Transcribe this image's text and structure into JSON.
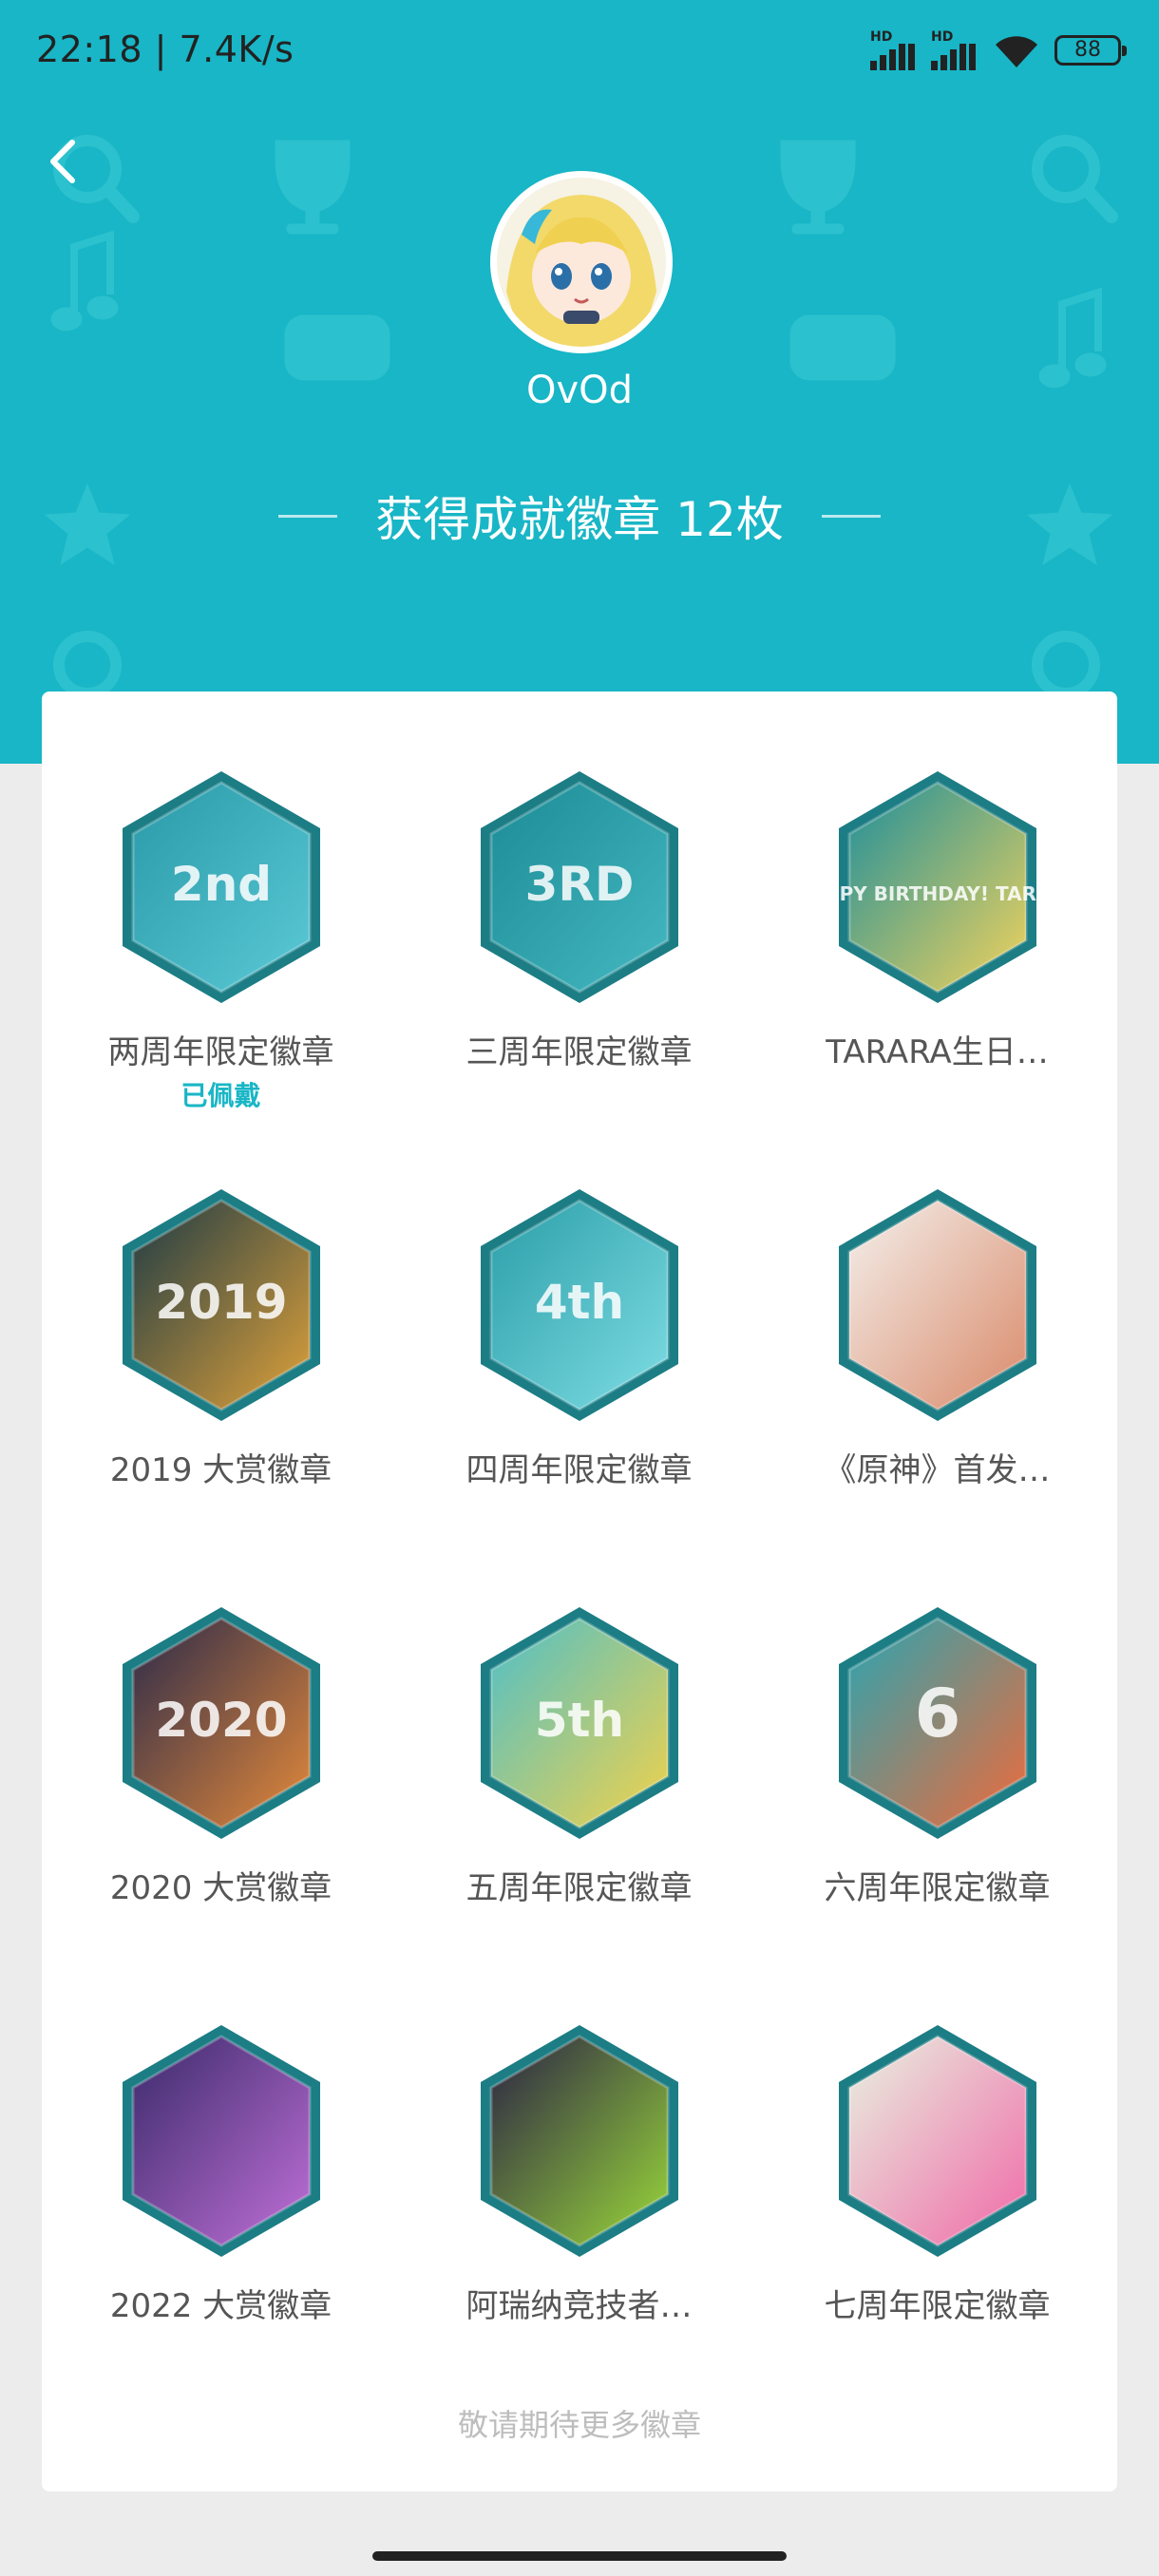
{
  "status_bar": {
    "time": "22:18 | 7.4K/s",
    "signal_1": "HD",
    "signal_2": "HD",
    "battery": "88"
  },
  "header": {
    "username": "OvOd",
    "title": "获得成就徽章 12枚"
  },
  "badges": [
    {
      "label": "两周年限定徽章",
      "status": "已佩戴",
      "text": "2nd",
      "colors": [
        "#2a9aa8",
        "#5bc9d6"
      ]
    },
    {
      "label": "三周年限定徽章",
      "text": "3RD",
      "colors": [
        "#1c8c96",
        "#45b8c2"
      ]
    },
    {
      "label": "TARARA生日…",
      "text": "HAPPY BIRTHDAY! TARARA",
      "colors": [
        "#1f8f9a",
        "#f2d35c"
      ]
    },
    {
      "label": "2019 大赏徽章",
      "text": "2019",
      "colors": [
        "#1d3b45",
        "#e0a23a"
      ]
    },
    {
      "label": "四周年限定徽章",
      "text": "4th",
      "colors": [
        "#2b9ea8",
        "#7fdde4"
      ]
    },
    {
      "label": "《原神》首发…",
      "text": "",
      "colors": [
        "#f4f0ec",
        "#d98a6a"
      ]
    },
    {
      "label": "2020 大赏徽章",
      "text": "2020",
      "colors": [
        "#2b2a4a",
        "#e58a3a"
      ]
    },
    {
      "label": "五周年限定徽章",
      "text": "5th",
      "colors": [
        "#4fbfc8",
        "#f2d24a"
      ]
    },
    {
      "label": "六周年限定徽章",
      "text": "6",
      "colors": [
        "#2aa5b2",
        "#ef6a3a"
      ]
    },
    {
      "label": "2022 大赏徽章",
      "text": "",
      "colors": [
        "#3a2a6a",
        "#c070d8"
      ]
    },
    {
      "label": "阿瑞纳竞技者…",
      "text": "",
      "colors": [
        "#2a2244",
        "#9ad83a"
      ]
    },
    {
      "label": "七周年限定徽章",
      "text": "",
      "colors": [
        "#e8f2e0",
        "#f06aa8"
      ]
    }
  ],
  "footer_note": "敬请期待更多徽章",
  "icons": {
    "back": "chevron-left-icon",
    "avatar": "avatar",
    "signal": "signal-icon",
    "wifi": "wifi-icon",
    "battery": "battery-icon"
  },
  "colors": {
    "accent": "#18b6c6",
    "badge_border": "#1c7d85"
  }
}
